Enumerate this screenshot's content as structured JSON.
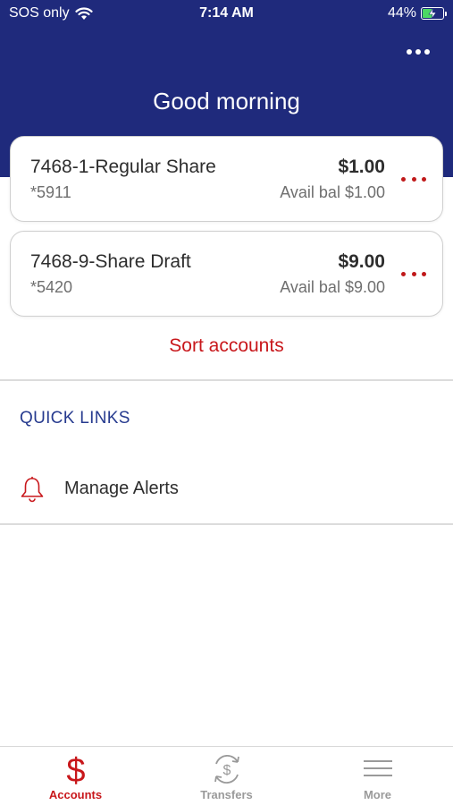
{
  "status_bar": {
    "carrier": "SOS only",
    "time": "7:14 AM",
    "battery": "44%",
    "battery_level": 0.44,
    "icons": [
      "wifi-icon",
      "battery-charging-icon"
    ]
  },
  "header": {
    "greeting": "Good morning",
    "more_icon": "ellipsis-icon"
  },
  "accounts": [
    {
      "name": "7468-1-Regular Share",
      "number": "*5911",
      "balance": "$1.00",
      "available": "Avail bal $1.00"
    },
    {
      "name": "7468-9-Share Draft",
      "number": "*5420",
      "balance": "$9.00",
      "available": "Avail bal $9.00"
    }
  ],
  "sort_label": "Sort accounts",
  "quick_links": {
    "title": "QUICK LINKS",
    "items": [
      {
        "label": "Manage Alerts",
        "icon": "bell-icon"
      }
    ]
  },
  "tabs": [
    {
      "label": "Accounts",
      "icon": "dollar-icon",
      "active": true
    },
    {
      "label": "Transfers",
      "icon": "transfer-icon",
      "active": false
    },
    {
      "label": "More",
      "icon": "menu-icon",
      "active": false
    }
  ],
  "colors": {
    "header_bg": "#1f2a7c",
    "accent_red": "#c8171b",
    "link_blue": "#273b8f"
  }
}
